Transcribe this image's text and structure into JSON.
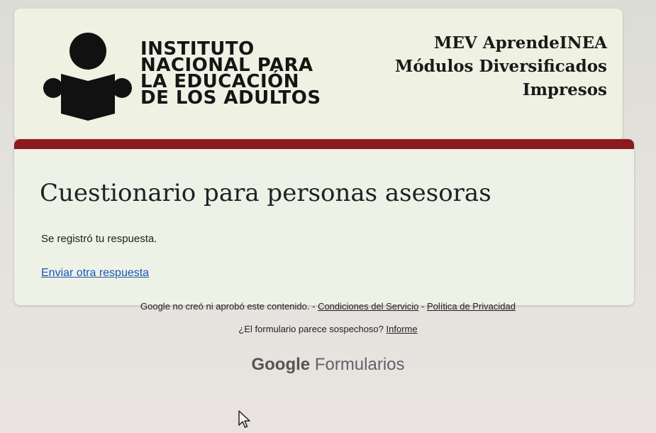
{
  "header": {
    "institute_lines": [
      "INSTITUTO",
      "NACIONAL PARA",
      "LA EDUCACIÓN",
      "DE LOS ADULTOS"
    ],
    "mev_lines": [
      "MEV AprendeINEA",
      "Módulos Diversificados",
      "Impresos"
    ],
    "logo_icon": "person-reading-book-icon"
  },
  "form": {
    "title": "Cuestionario para personas asesoras",
    "confirmation": "Se registró tu respuesta.",
    "another_response_link": "Enviar otra respuesta",
    "accent_color": "#8b1a1f"
  },
  "footer": {
    "disclaimer": "Google no creó ni aprobó este contenido. - ",
    "terms_link": "Condiciones del Servicio",
    "separator": " - ",
    "privacy_link": "Política de Privacidad",
    "suspicious_text": "¿El formulario parece sospechoso? ",
    "report_link": "Informe",
    "brand_google": "Google",
    "brand_forms": "Formularios"
  }
}
